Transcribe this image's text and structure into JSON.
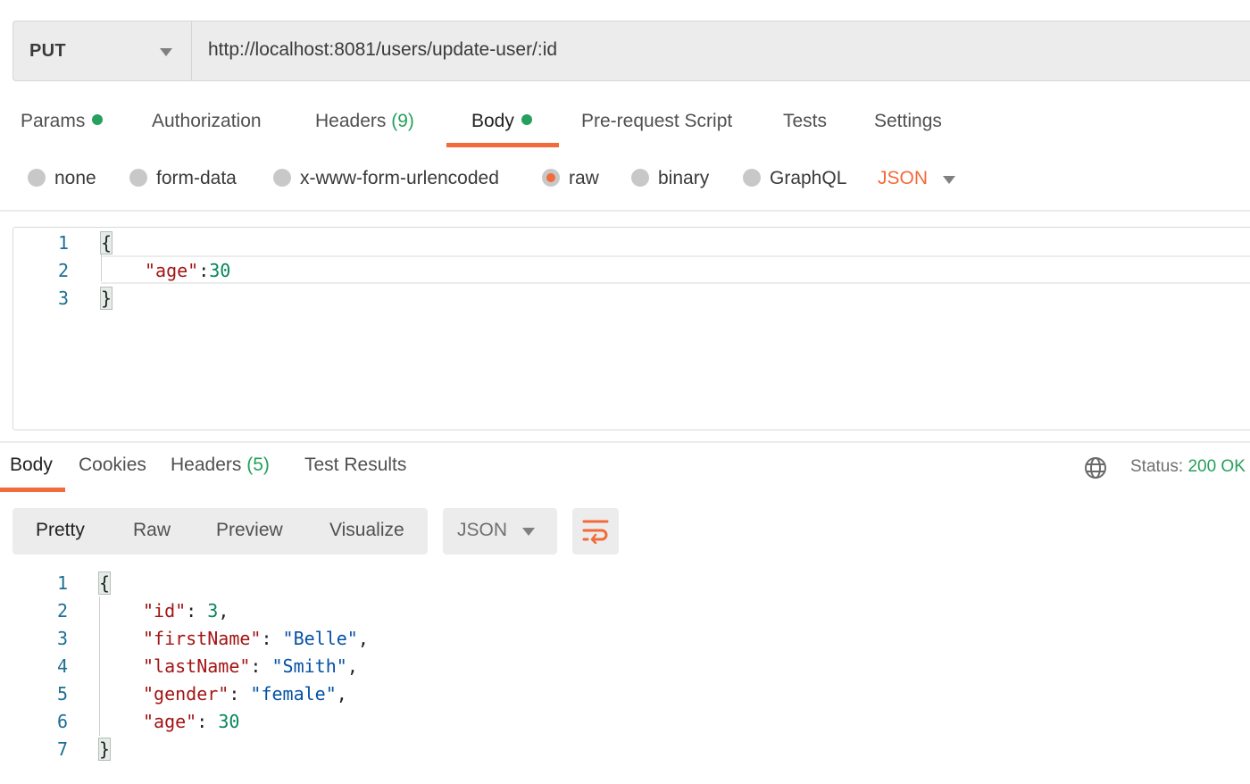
{
  "request": {
    "method": "PUT",
    "url": "http://localhost:8081/users/update-user/:id",
    "tabs": [
      {
        "label": "Params",
        "indicator": true
      },
      {
        "label": "Authorization"
      },
      {
        "label": "Headers",
        "count": "(9)"
      },
      {
        "label": "Body",
        "indicator": true,
        "active": true
      },
      {
        "label": "Pre-request Script"
      },
      {
        "label": "Tests"
      },
      {
        "label": "Settings"
      }
    ],
    "body_types": [
      {
        "label": "none"
      },
      {
        "label": "form-data"
      },
      {
        "label": "x-www-form-urlencoded"
      },
      {
        "label": "raw",
        "selected": true
      },
      {
        "label": "binary"
      },
      {
        "label": "GraphQL"
      }
    ],
    "language": "JSON",
    "body_lines": [
      {
        "num": "1",
        "text": "{"
      },
      {
        "num": "2",
        "key": "\"age\"",
        "sep": ":",
        "value": "30"
      },
      {
        "num": "3",
        "text": "}"
      }
    ]
  },
  "response": {
    "tabs": [
      {
        "label": "Body",
        "active": true
      },
      {
        "label": "Cookies"
      },
      {
        "label": "Headers",
        "count": "(5)"
      },
      {
        "label": "Test Results"
      }
    ],
    "status_label": "Status:",
    "status_value": "200 OK",
    "views": [
      "Pretty",
      "Raw",
      "Preview",
      "Visualize"
    ],
    "active_view": "Pretty",
    "format": "JSON",
    "body_lines": [
      {
        "num": "1",
        "text": "{"
      },
      {
        "num": "2",
        "key": "\"id\"",
        "value": "3",
        "type": "number",
        "comma": ","
      },
      {
        "num": "3",
        "key": "\"firstName\"",
        "value": "\"Belle\"",
        "type": "string",
        "comma": ","
      },
      {
        "num": "4",
        "key": "\"lastName\"",
        "value": "\"Smith\"",
        "type": "string",
        "comma": ","
      },
      {
        "num": "5",
        "key": "\"gender\"",
        "value": "\"female\"",
        "type": "string",
        "comma": ","
      },
      {
        "num": "6",
        "key": "\"age\"",
        "value": "30",
        "type": "number",
        "comma": ""
      },
      {
        "num": "7",
        "text": "}"
      }
    ]
  },
  "colors": {
    "accent": "#f26b3a",
    "success": "#26a05c",
    "json_key": "#a31515",
    "json_number": "#098658",
    "json_string": "#0451a5"
  }
}
